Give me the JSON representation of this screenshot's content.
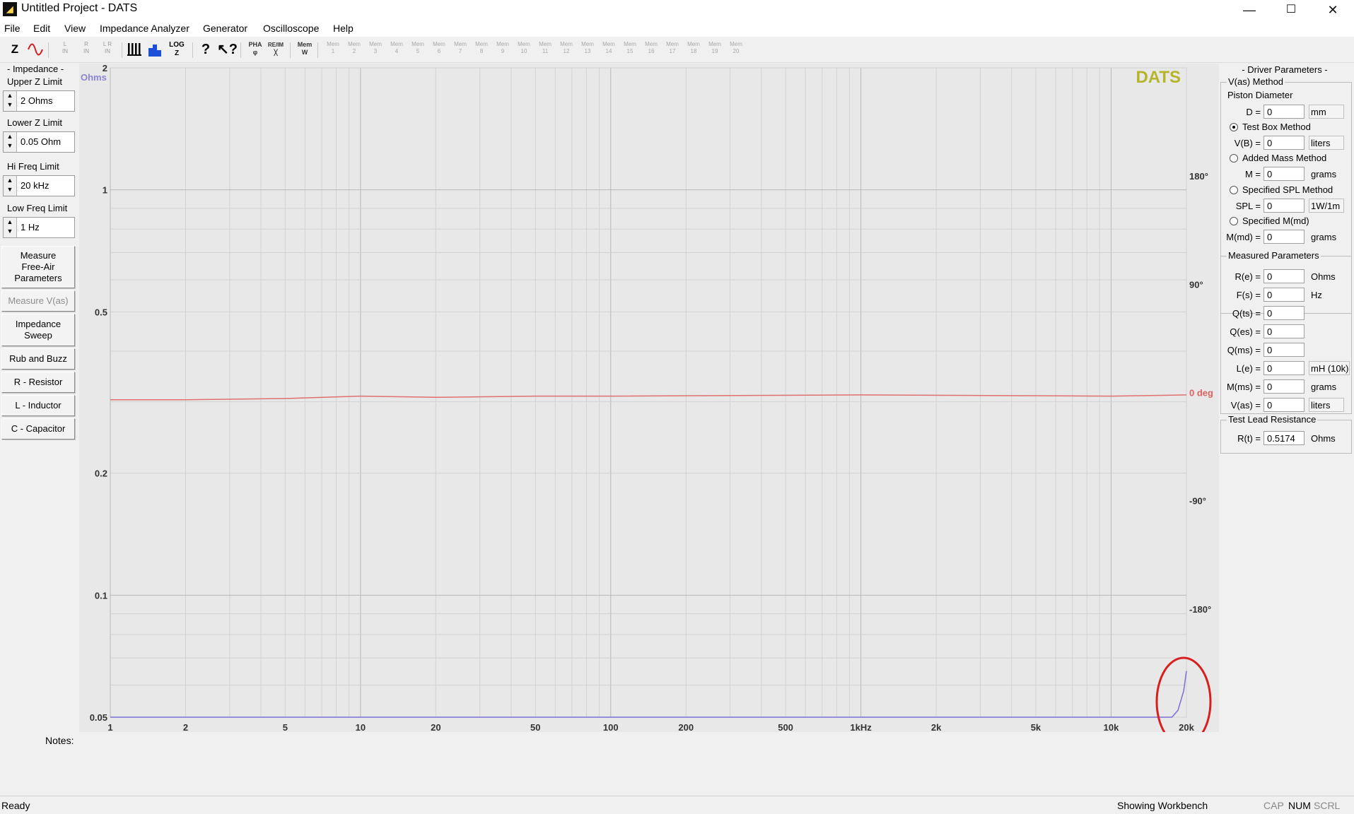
{
  "window": {
    "title": "Untitled Project - DATS",
    "controls": {
      "minimize": "—",
      "maximize": "☐",
      "close": "✕"
    }
  },
  "menu": [
    "File",
    "Edit",
    "View",
    "Impedance Analyzer",
    "Generator",
    "Oscilloscope",
    "Help"
  ],
  "toolbar": {
    "z_label": "Z",
    "phase_icon": "sine-wave-icon",
    "in_buttons": [
      {
        "top": "L",
        "bottom": "IN"
      },
      {
        "top": "R",
        "bottom": "IN"
      },
      {
        "top": "L R",
        "bottom": "IN"
      }
    ],
    "log_label": "LOG",
    "pha_label": "PHA",
    "re_im_label": "RE/IM",
    "mem_label": "Mem",
    "mem_numbers": [
      "1",
      "2",
      "3",
      "4",
      "5",
      "6",
      "7",
      "8",
      "9",
      "10",
      "11",
      "12",
      "13",
      "14",
      "15",
      "16",
      "17",
      "18",
      "19",
      "20"
    ]
  },
  "left_panel": {
    "impedance_title": "- Impedance -",
    "upper_z": {
      "label": "Upper Z Limit",
      "value": "2 Ohms"
    },
    "lower_z": {
      "label": "Lower Z Limit",
      "value": "0.05 Ohm"
    },
    "hi_freq": {
      "label": "Hi Freq Limit",
      "value": "20 kHz"
    },
    "low_freq": {
      "label": "Low Freq Limit",
      "value": "1 Hz"
    },
    "buttons": {
      "measure_free_air": "Measure\nFree-Air\nParameters",
      "measure_vas": "Measure V(as)",
      "impedance_sweep": "Impedance\nSweep",
      "rub_and_buzz": "Rub and Buzz",
      "resistor": "R - Resistor",
      "inductor": "L - Inductor",
      "capacitor": "C - Capacitor"
    }
  },
  "chart_data": {
    "type": "line",
    "title": "",
    "xlabel": "",
    "ylabel": "Ohms",
    "y2label": "",
    "x_scale": "log",
    "y_scale": "log",
    "xlim": [
      1,
      20000
    ],
    "ylim": [
      0.05,
      2
    ],
    "y2lim": [
      -270,
      270
    ],
    "x_ticks": [
      {
        "value": 1,
        "label": "1"
      },
      {
        "value": 2,
        "label": "2"
      },
      {
        "value": 5,
        "label": "5"
      },
      {
        "value": 10,
        "label": "10"
      },
      {
        "value": 20,
        "label": "20"
      },
      {
        "value": 50,
        "label": "50"
      },
      {
        "value": 100,
        "label": "100"
      },
      {
        "value": 200,
        "label": "200"
      },
      {
        "value": 500,
        "label": "500"
      },
      {
        "value": 1000,
        "label": "1kHz"
      },
      {
        "value": 2000,
        "label": "2k"
      },
      {
        "value": 5000,
        "label": "5k"
      },
      {
        "value": 10000,
        "label": "10k"
      },
      {
        "value": 20000,
        "label": "20k"
      }
    ],
    "y_ticks": [
      {
        "value": 2,
        "label": "2"
      },
      {
        "value": 1,
        "label": "1"
      },
      {
        "value": 0.5,
        "label": "0.5"
      },
      {
        "value": 0.2,
        "label": "0.2"
      },
      {
        "value": 0.1,
        "label": "0.1"
      },
      {
        "value": 0.05,
        "label": "0.05"
      }
    ],
    "y2_ticks": [
      {
        "value": 180,
        "label": "180°"
      },
      {
        "value": 90,
        "label": "90°"
      },
      {
        "value": 0,
        "label": "0 deg"
      },
      {
        "value": -90,
        "label": "-90°"
      },
      {
        "value": -180,
        "label": "-180°"
      }
    ],
    "grid": true,
    "watermark": "DATS",
    "series": [
      {
        "axis": "left",
        "color": "#7b6fd6",
        "x": [
          1,
          2,
          5,
          10,
          100,
          1000,
          10000,
          17500,
          18500,
          19500,
          20000
        ],
        "y": [
          0.05,
          0.05,
          0.05,
          0.05,
          0.05,
          0.05,
          0.05,
          0.05,
          0.052,
          0.058,
          0.065
        ]
      },
      {
        "axis": "right",
        "color": "#e07070",
        "x": [
          1,
          2,
          5,
          10,
          20,
          50,
          100,
          1000,
          10000,
          20000
        ],
        "y": [
          -6,
          -6,
          -5,
          -3,
          -4,
          -3,
          -3,
          -2,
          -3,
          -2
        ]
      }
    ],
    "annotation": {
      "shape": "ellipse",
      "color": "#d81f1f",
      "around_x": 20000
    }
  },
  "right_panel": {
    "title": "- Driver Parameters -",
    "vas_method": {
      "title": "V(as) Method",
      "piston_diameter_label": "Piston Diameter",
      "d": {
        "label": "D =",
        "value": "0",
        "unit": "mm"
      },
      "test_box": {
        "label": "Test Box Method",
        "checked": true
      },
      "vb": {
        "label": "V(B) =",
        "value": "0",
        "unit": "liters"
      },
      "added_mass": {
        "label": "Added Mass Method",
        "checked": false
      },
      "m": {
        "label": "M =",
        "value": "0",
        "unit": "grams"
      },
      "specified_spl": {
        "label": "Specified SPL Method",
        "checked": false
      },
      "spl": {
        "label": "SPL =",
        "value": "0",
        "unit": "1W/1m"
      },
      "specified_mmd": {
        "label": "Specified M(md)",
        "checked": false
      },
      "mmd": {
        "label": "M(md) =",
        "value": "0",
        "unit": "grams"
      }
    },
    "measured": {
      "title": "Measured Parameters",
      "rows": [
        {
          "label": "R(e) =",
          "value": "0",
          "unit": "Ohms"
        },
        {
          "label": "F(s) =",
          "value": "0",
          "unit": "Hz"
        },
        {
          "label": "Q(ts) =",
          "value": "0",
          "unit": ""
        },
        {
          "label": "Q(es) =",
          "value": "0",
          "unit": ""
        },
        {
          "label": "Q(ms) =",
          "value": "0",
          "unit": ""
        },
        {
          "label": "L(e) =",
          "value": "0",
          "unit": "mH (10k)"
        },
        {
          "label": "M(ms) =",
          "value": "0",
          "unit": "grams"
        },
        {
          "label": "V(as) =",
          "value": "0",
          "unit": "liters"
        }
      ]
    },
    "test_lead": {
      "title": "Test Lead Resistance",
      "rt": {
        "label": "R(t) =",
        "value": "0.5174",
        "unit": "Ohms"
      }
    }
  },
  "notes_label": "Notes:",
  "status": {
    "left": "Ready",
    "center": "Showing Workbench",
    "cap": "CAP",
    "num": "NUM",
    "scrl": "SCRL"
  }
}
